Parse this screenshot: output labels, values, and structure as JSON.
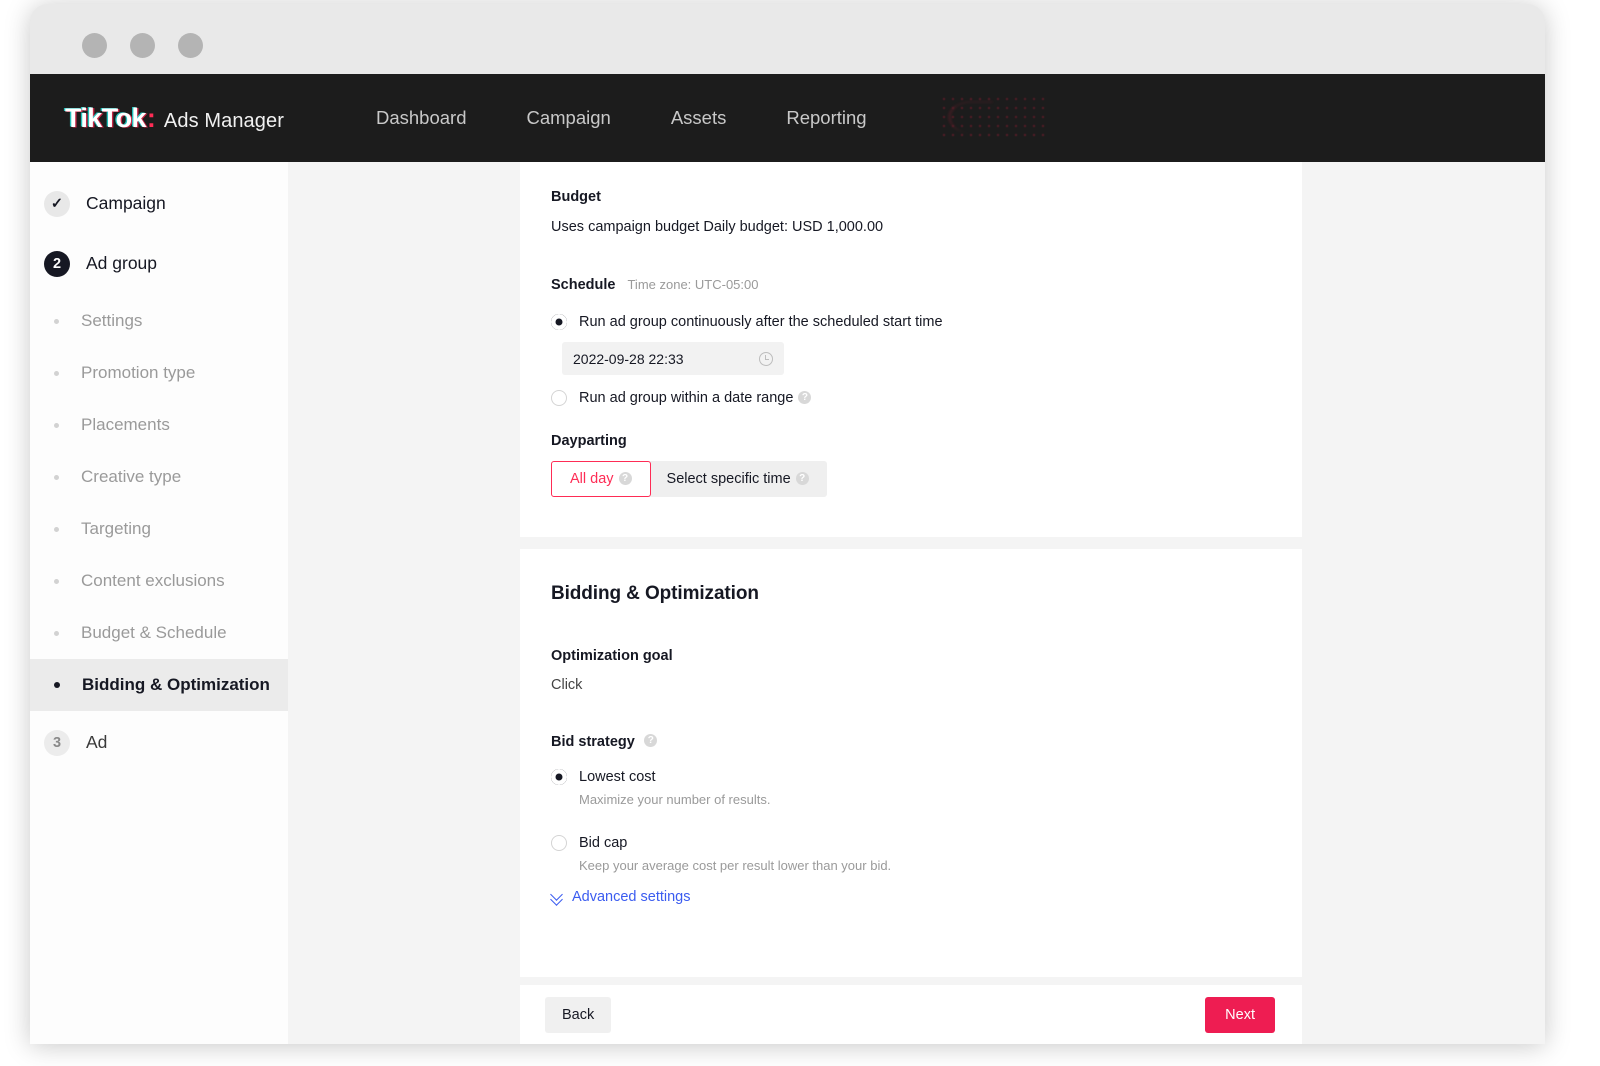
{
  "window": {
    "dots": [
      "window-close-dot",
      "window-minimize-dot",
      "window-maximize-dot"
    ]
  },
  "topnav": {
    "brand_tiktok": "TikTok",
    "brand_colon": ":",
    "brand_suffix": "Ads Manager",
    "links": [
      {
        "label": "Dashboard"
      },
      {
        "label": "Campaign"
      },
      {
        "label": "Assets"
      },
      {
        "label": "Reporting"
      }
    ],
    "redacted_label": ""
  },
  "sidebar": {
    "steps": [
      {
        "marker": "✓",
        "label": "Campaign",
        "state": "done"
      },
      {
        "marker": "2",
        "label": "Ad group",
        "state": "current"
      }
    ],
    "subitems": [
      {
        "label": "Settings",
        "active": false
      },
      {
        "label": "Promotion type",
        "active": false
      },
      {
        "label": "Placements",
        "active": false
      },
      {
        "label": "Creative type",
        "active": false
      },
      {
        "label": "Targeting",
        "active": false
      },
      {
        "label": "Content exclusions",
        "active": false
      },
      {
        "label": "Budget & Schedule",
        "active": false
      },
      {
        "label": "Bidding & Optimization",
        "active": true
      }
    ],
    "last_step": {
      "marker": "3",
      "label": "Ad",
      "state": "future"
    }
  },
  "schedule_card": {
    "budget_label": "Budget",
    "budget_value": "Uses campaign budget Daily budget: USD 1,000.00",
    "schedule_label": "Schedule",
    "timezone": "Time zone: UTC-05:00",
    "option_continuous": "Run ad group continuously after the scheduled start time",
    "start_datetime": "2022-09-28 22:33",
    "option_daterange": "Run ad group within a date range",
    "dayparting_label": "Dayparting",
    "tab_all_day": "All day",
    "tab_specific_time": "Select specific time",
    "help_glyph": "?"
  },
  "bidding_card": {
    "title": "Bidding & Optimization",
    "optimization_goal_label": "Optimization goal",
    "optimization_goal_value": "Click",
    "bid_strategy_label": "Bid strategy",
    "strategies": [
      {
        "label": "Lowest cost",
        "desc": "Maximize your number of results.",
        "selected": true
      },
      {
        "label": "Bid cap",
        "desc": "Keep your average cost per result lower than your bid.",
        "selected": false
      }
    ],
    "advanced_settings": "Advanced settings",
    "help_glyph": "?"
  },
  "footer": {
    "back_label": "Back",
    "next_label": "Next"
  },
  "colors": {
    "brand_pink": "#FE2C55",
    "next_button": "#EE1D52",
    "link_blue": "#3B5CF0",
    "nav_background": "#1C1C1C",
    "page_background": "#F4F4F4"
  }
}
